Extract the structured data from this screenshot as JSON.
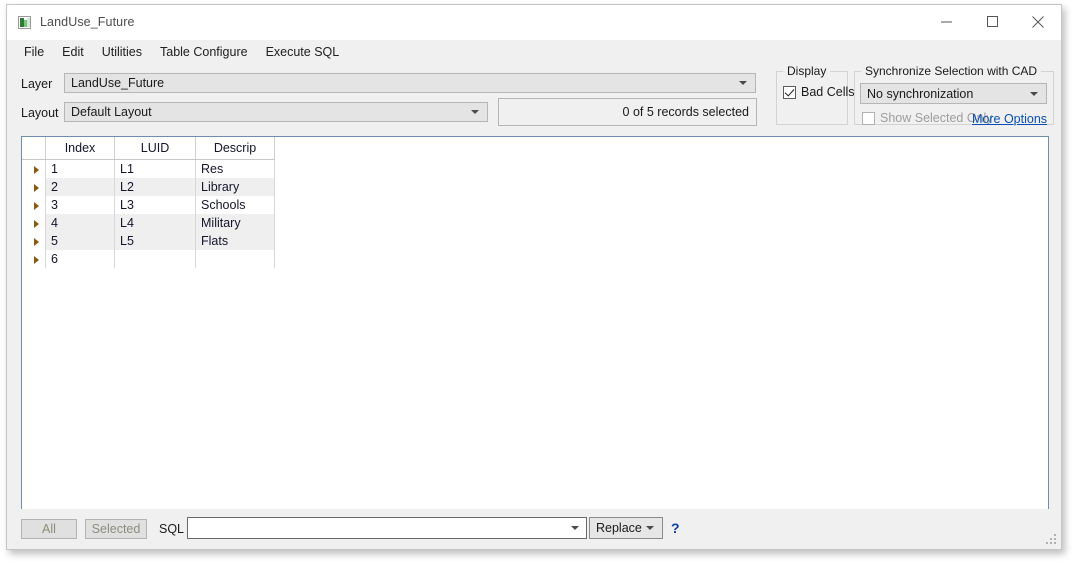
{
  "window": {
    "title": "LandUse_Future",
    "icon": "app-chart-icon",
    "controls": {
      "minimize": "minimize-icon",
      "maximize": "maximize-icon",
      "close": "close-icon"
    }
  },
  "menubar": {
    "items": [
      {
        "label": "File"
      },
      {
        "label": "Edit"
      },
      {
        "label": "Utilities"
      },
      {
        "label": "Table Configure"
      },
      {
        "label": "Execute SQL"
      }
    ]
  },
  "form": {
    "layer_label": "Layer",
    "layer_value": "LandUse_Future",
    "layout_label": "Layout",
    "layout_value": "Default Layout",
    "records_status": "0 of 5 records selected"
  },
  "display_group": {
    "title": "Display",
    "bad_cells_label": "Bad Cells",
    "bad_cells_checked": true
  },
  "sync_group": {
    "title": "Synchronize Selection with CAD",
    "sync_value": "No synchronization",
    "show_selected_only_label": "Show Selected Only",
    "show_selected_only_checked": false,
    "more_options_label": "More Options"
  },
  "grid": {
    "columns": [
      "Index",
      "LUID",
      "Descrip"
    ],
    "rows": [
      {
        "index": "1",
        "luid": "L1",
        "descrip": "Res"
      },
      {
        "index": "2",
        "luid": "L2",
        "descrip": "Library"
      },
      {
        "index": "3",
        "luid": "L3",
        "descrip": "Schools"
      },
      {
        "index": "4",
        "luid": "L4",
        "descrip": "Military"
      },
      {
        "index": "5",
        "luid": "L5",
        "descrip": "Flats"
      },
      {
        "index": "6",
        "luid": "",
        "descrip": ""
      }
    ]
  },
  "bottombar": {
    "all_label": "All",
    "selected_label": "Selected",
    "sql_label": "SQL",
    "sql_value": "",
    "mode_value": "Replace",
    "help_label": "?"
  },
  "colors": {
    "window_bg": "#f0f0f0",
    "grid_border": "#6f8ead",
    "link": "#0a4fb5",
    "help": "#0b40a8",
    "row_arrow": "#8a5a12"
  }
}
